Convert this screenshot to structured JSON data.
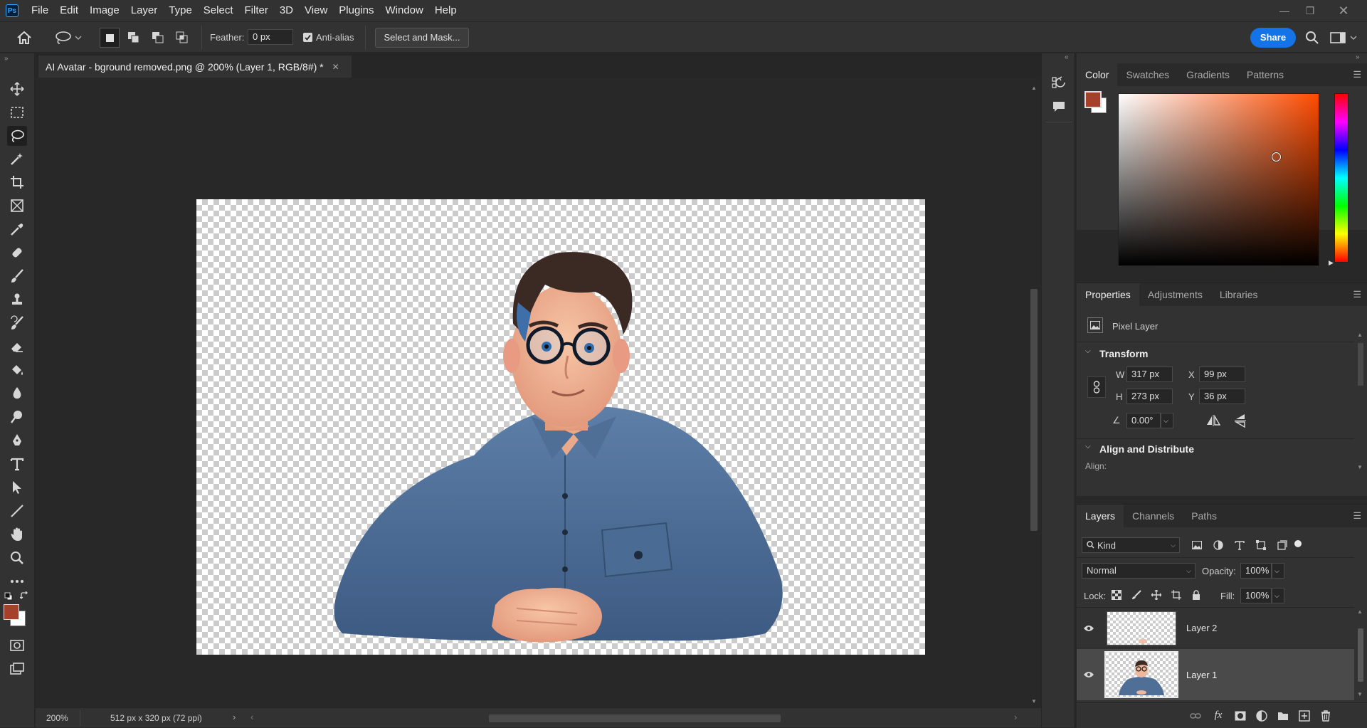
{
  "app": {
    "logo": "Ps"
  },
  "menu": [
    "File",
    "Edit",
    "Image",
    "Layer",
    "Type",
    "Select",
    "Filter",
    "3D",
    "View",
    "Plugins",
    "Window",
    "Help"
  ],
  "options_bar": {
    "feather_label": "Feather:",
    "feather_value": "0 px",
    "antialias_label": "Anti-alias",
    "antialias_checked": true,
    "select_mask_label": "Select and Mask...",
    "share_label": "Share"
  },
  "document": {
    "tab_title": "AI Avatar - bground removed.png @ 200% (Layer 1, RGB/8#) *"
  },
  "status": {
    "zoom": "200%",
    "info": "512 px x 320 px (72 ppi)"
  },
  "colors": {
    "foreground": "#a5402a",
    "background": "#ffffff",
    "accent": "#1473e6"
  },
  "color_panel": {
    "tabs": [
      "Color",
      "Swatches",
      "Gradients",
      "Patterns"
    ],
    "active_tab": "Color"
  },
  "properties_panel": {
    "tabs": [
      "Properties",
      "Adjustments",
      "Libraries"
    ],
    "layer_type": "Pixel Layer",
    "transform_title": "Transform",
    "w_label": "W",
    "w_value": "317 px",
    "h_label": "H",
    "h_value": "273 px",
    "x_label": "X",
    "x_value": "99 px",
    "y_label": "Y",
    "y_value": "36 px",
    "angle_value": "0.00°",
    "align_title": "Align and Distribute",
    "align_label": "Align:"
  },
  "layers_panel": {
    "tabs": [
      "Layers",
      "Channels",
      "Paths"
    ],
    "filter_kind": "Kind",
    "blend_mode": "Normal",
    "opacity_label": "Opacity:",
    "opacity_value": "100%",
    "lock_label": "Lock:",
    "fill_label": "Fill:",
    "fill_value": "100%",
    "layers": [
      {
        "name": "Layer 2",
        "visible": true,
        "selected": false
      },
      {
        "name": "Layer 1",
        "visible": true,
        "selected": true
      }
    ]
  },
  "icons": {
    "tools": [
      "move-icon",
      "marquee-icon",
      "lasso-icon",
      "magic-wand-icon",
      "crop-icon",
      "frame-icon",
      "eyedropper-icon",
      "healing-brush-icon",
      "brush-icon",
      "clone-stamp-icon",
      "history-brush-icon",
      "eraser-icon",
      "paint-bucket-icon",
      "blur-icon",
      "dodge-icon",
      "pen-icon",
      "type-icon",
      "path-selection-icon",
      "line-icon",
      "hand-icon",
      "zoom-icon",
      "more-tools-icon"
    ]
  }
}
